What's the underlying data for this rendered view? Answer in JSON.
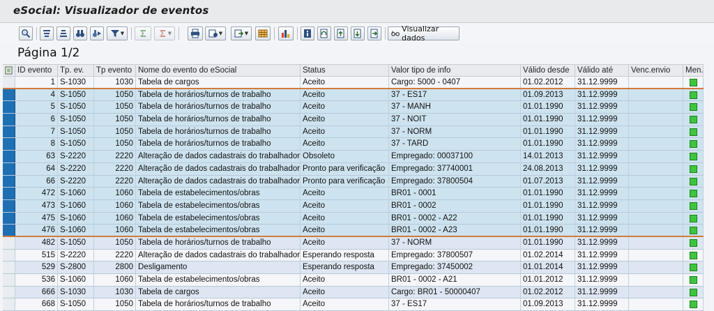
{
  "window": {
    "title": "eSocial: Visualizador de eventos"
  },
  "toolbar": {
    "visualizar_label": "Visualizar dados"
  },
  "page_indicator": "Página 1/2",
  "table": {
    "headers": {
      "id": "ID evento",
      "tp_ev": "Tp. ev.",
      "tp_evento": "Tp evento",
      "nome": "Nome do evento do eSocial",
      "status": "Status",
      "valor": "Valor tipo de info",
      "valido_desde": "Válido desde",
      "valido_ate": "Válido até",
      "venc": "Venc.envio",
      "men": "Men..."
    },
    "rows": [
      {
        "id": "1",
        "tp": "S-1030",
        "tpe": "1030",
        "nome": "Tabela de cargos",
        "status": "Aceito",
        "valor": "Cargo: 5000 - 0407",
        "desde": "01.02.2012",
        "ate": "31.12.9999",
        "venc": ""
      },
      {
        "id": "4",
        "tp": "S-1050",
        "tpe": "1050",
        "nome": "Tabela de horários/turnos de trabalho",
        "status": "Aceito",
        "valor": "37 - ES17",
        "desde": "01.09.2013",
        "ate": "31.12.9999",
        "venc": ""
      },
      {
        "id": "5",
        "tp": "S-1050",
        "tpe": "1050",
        "nome": "Tabela de horários/turnos de trabalho",
        "status": "Aceito",
        "valor": "37 - MANH",
        "desde": "01.01.1990",
        "ate": "31.12.9999",
        "venc": ""
      },
      {
        "id": "6",
        "tp": "S-1050",
        "tpe": "1050",
        "nome": "Tabela de horários/turnos de trabalho",
        "status": "Aceito",
        "valor": "37 - NOIT",
        "desde": "01.01.1990",
        "ate": "31.12.9999",
        "venc": ""
      },
      {
        "id": "7",
        "tp": "S-1050",
        "tpe": "1050",
        "nome": "Tabela de horários/turnos de trabalho",
        "status": "Aceito",
        "valor": "37 - NORM",
        "desde": "01.01.1990",
        "ate": "31.12.9999",
        "venc": ""
      },
      {
        "id": "8",
        "tp": "S-1050",
        "tpe": "1050",
        "nome": "Tabela de horários/turnos de trabalho",
        "status": "Aceito",
        "valor": "37 - TARD",
        "desde": "01.01.1990",
        "ate": "31.12.9999",
        "venc": ""
      },
      {
        "id": "63",
        "tp": "S-2220",
        "tpe": "2220",
        "nome": "Alteração de dados cadastrais do trabalhador",
        "status": "Obsoleto",
        "valor": "Empregado: 00037100",
        "desde": "14.01.2013",
        "ate": "31.12.9999",
        "venc": ""
      },
      {
        "id": "64",
        "tp": "S-2220",
        "tpe": "2220",
        "nome": "Alteração de dados cadastrais do trabalhador",
        "status": "Pronto para verificação",
        "valor": "Empregado: 37740001",
        "desde": "24.08.2013",
        "ate": "31.12.9999",
        "venc": ""
      },
      {
        "id": "66",
        "tp": "S-2220",
        "tpe": "2220",
        "nome": "Alteração de dados cadastrais do trabalhador",
        "status": "Pronto para verificação",
        "valor": "Empregado: 37800504",
        "desde": "01.07.2013",
        "ate": "31.12.9999",
        "venc": ""
      },
      {
        "id": "472",
        "tp": "S-1060",
        "tpe": "1060",
        "nome": "Tabela de estabelecimentos/obras",
        "status": "Aceito",
        "valor": "BR01 - 0001",
        "desde": "01.01.1990",
        "ate": "31.12.9999",
        "venc": ""
      },
      {
        "id": "473",
        "tp": "S-1060",
        "tpe": "1060",
        "nome": "Tabela de estabelecimentos/obras",
        "status": "Aceito",
        "valor": "BR01 - 0002",
        "desde": "01.01.1990",
        "ate": "31.12.9999",
        "venc": ""
      },
      {
        "id": "475",
        "tp": "S-1060",
        "tpe": "1060",
        "nome": "Tabela de estabelecimentos/obras",
        "status": "Aceito",
        "valor": "BR01 - 0002 - A22",
        "desde": "01.01.1990",
        "ate": "31.12.9999",
        "venc": ""
      },
      {
        "id": "476",
        "tp": "S-1060",
        "tpe": "1060",
        "nome": "Tabela de estabelecimentos/obras",
        "status": "Aceito",
        "valor": "BR01 - 0002 - A23",
        "desde": "01.01.1990",
        "ate": "31.12.9999",
        "venc": ""
      },
      {
        "id": "482",
        "tp": "S-1050",
        "tpe": "1050",
        "nome": "Tabela de horários/turnos de trabalho",
        "status": "Aceito",
        "valor": "37 - NORM",
        "desde": "01.01.1990",
        "ate": "31.12.9999",
        "venc": ""
      },
      {
        "id": "515",
        "tp": "S-2220",
        "tpe": "2220",
        "nome": "Alteração de dados cadastrais do trabalhador",
        "status": "Esperando resposta",
        "valor": "Empregado: 37800507",
        "desde": "01.02.2014",
        "ate": "31.12.9999",
        "venc": ""
      },
      {
        "id": "529",
        "tp": "S-2800",
        "tpe": "2800",
        "nome": "Desligamento",
        "status": "Esperando resposta",
        "valor": "Empregado: 37450002",
        "desde": "01.01.2014",
        "ate": "31.12.9999",
        "venc": ""
      },
      {
        "id": "536",
        "tp": "S-1060",
        "tpe": "1060",
        "nome": "Tabela de estabelecimentos/obras",
        "status": "Aceito",
        "valor": "BR01 - 0002 - A21",
        "desde": "01.01.2012",
        "ate": "31.12.9999",
        "venc": ""
      },
      {
        "id": "666",
        "tp": "S-1030",
        "tpe": "1030",
        "nome": "Tabela de cargos",
        "status": "Aceito",
        "valor": "Cargo: BR01 - 50000407",
        "desde": "01.02.2012",
        "ate": "31.12.9999",
        "venc": ""
      },
      {
        "id": "668",
        "tp": "S-1050",
        "tpe": "1050",
        "nome": "Tabela de horários/turnos de trabalho",
        "status": "Aceito",
        "valor": "37 - ES17",
        "desde": "01.09.2013",
        "ate": "31.12.9999",
        "venc": ""
      }
    ]
  },
  "colors": {
    "selected_row": "#cde3ef",
    "selection_marker": "#1f6fb3",
    "status_green": "#3fc43f",
    "separator_orange": "#d07b3c"
  }
}
